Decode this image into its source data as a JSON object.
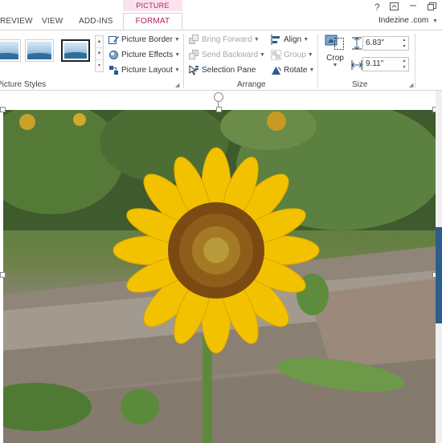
{
  "tabs": {
    "contextual_header": "PICTURE TOOLS",
    "review": "REVIEW",
    "view": "VIEW",
    "addins": "ADD-INS",
    "format": "FORMAT"
  },
  "title_bar": {
    "help": "?",
    "user": "Indezine .com"
  },
  "ribbon": {
    "picture_styles": {
      "label": "Picture Styles",
      "picture_border": "Picture Border",
      "picture_effects": "Picture Effects",
      "picture_layout": "Picture Layout"
    },
    "arrange": {
      "label": "Arrange",
      "bring_forward": "Bring Forward",
      "send_backward": "Send Backward",
      "selection_pane": "Selection Pane",
      "align": "Align",
      "group": "Group",
      "rotate": "Rotate"
    },
    "size": {
      "label": "Size",
      "crop": "Crop",
      "height": "6.83\"",
      "width": "9.11\""
    }
  },
  "colors": {
    "accent": "#b0215f",
    "accent_bg": "#fbe3ee",
    "disabled_text": "#a8a8a8",
    "petal_yellow": "#f2c200",
    "seed_brown": "#7a4a12"
  },
  "icons": {
    "picture_border": "pencil-border-icon",
    "picture_effects": "effects-icon",
    "picture_layout": "layout-icon",
    "bring_forward": "bring-forward-icon",
    "send_backward": "send-backward-icon",
    "selection_pane": "selection-pane-icon",
    "align": "align-icon",
    "group": "group-icon",
    "rotate": "rotate-icon",
    "crop": "crop-icon"
  }
}
